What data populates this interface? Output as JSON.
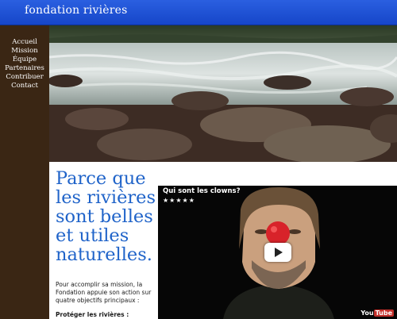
{
  "site": {
    "title": "fondation rivières"
  },
  "nav": {
    "items": [
      {
        "label": "Accueil"
      },
      {
        "label": "Mission"
      },
      {
        "label": "Équipe"
      },
      {
        "label": "Partenaires"
      },
      {
        "label": "Contribuer"
      },
      {
        "label": "Contact"
      }
    ]
  },
  "main": {
    "headline": "Parce que les rivières sont belles et utiles naturelles.",
    "intro": "Pour accomplir sa mission, la Fondation appuie son action sur quatre objectifs principaux :",
    "subhead": "Protéger les rivières :"
  },
  "video": {
    "title": "Qui sont les clowns?",
    "rating_text": "★★★★★",
    "logo_you": "You",
    "logo_tube": "Tube"
  },
  "colors": {
    "header_blue": "#1646c9",
    "sidebar_brown": "#3a2614",
    "headline_blue": "#1f63c9",
    "clown_nose_red": "#d8232a"
  },
  "icons": {
    "play": "play-icon",
    "stars": "star-rating-icon"
  }
}
